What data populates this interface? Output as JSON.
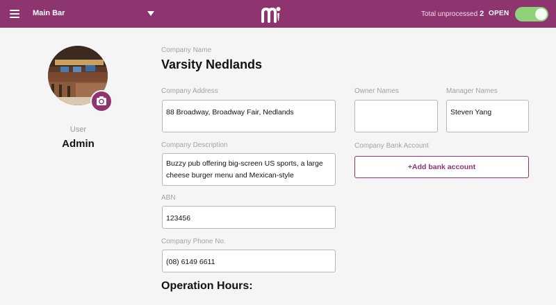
{
  "topbar": {
    "venue_name": "Main Bar",
    "unprocessed_label": "Total unprocessed",
    "unprocessed_count": "2",
    "status_label": "OPEN",
    "open": true,
    "colors": {
      "bar": "#8e3570",
      "toggle_on": "#8fd07a"
    }
  },
  "profile": {
    "role_label": "User",
    "role_value": "Admin"
  },
  "company": {
    "name_label": "Company Name",
    "name": "Varsity Nedlands",
    "address_label": "Company Address",
    "address": "88 Broadway, Broadway Fair, Nedlands",
    "description_label": "Company Description",
    "description": "Buzzy pub offering big-screen US sports, a large cheese burger menu and Mexican-style",
    "abn_label": "ABN",
    "abn": "123456",
    "phone_label": "Company Phone No.",
    "phone": "(08) 6149 6611",
    "owner_label": "Owner Names",
    "owner": "",
    "manager_label": "Manager Names",
    "manager": "Steven Yang",
    "bank_label": "Company Bank Account",
    "bank_button": "+Add bank account"
  },
  "operation_hours_title": "Operation Hours:",
  "icons": [
    "menu-icon",
    "dropdown-caret-icon",
    "app-logo-icon",
    "camera-refresh-icon"
  ]
}
